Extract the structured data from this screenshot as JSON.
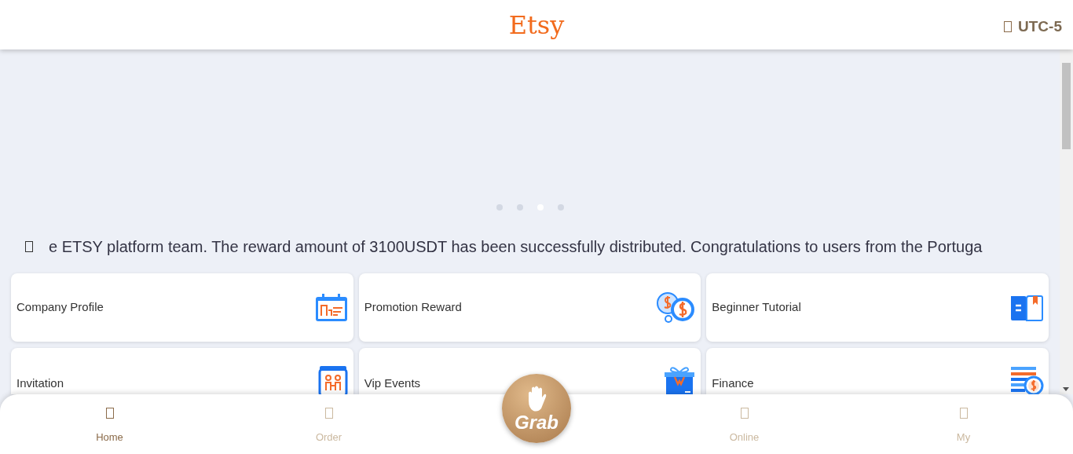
{
  "header": {
    "logo": "Etsy",
    "timezone": "UTC-5"
  },
  "carousel": {
    "dots": [
      {
        "selected": false
      },
      {
        "selected": false
      },
      {
        "selected": true
      },
      {
        "selected": false
      }
    ]
  },
  "notice": {
    "text": "e ETSY platform team. The reward amount of 3100USDT has been successfully distributed. Congratulations to users from the Portuga"
  },
  "menu": [
    {
      "label": "Company Profile",
      "kind": "profile"
    },
    {
      "label": "Promotion Reward",
      "kind": "coins"
    },
    {
      "label": "Beginner Tutorial",
      "kind": "book"
    },
    {
      "label": "Invitation",
      "kind": "invite"
    },
    {
      "label": "Vip Events",
      "kind": "gift"
    },
    {
      "label": "Finance",
      "kind": "finance"
    }
  ],
  "bottom_nav": {
    "items": [
      {
        "label": "Home",
        "selected": true
      },
      {
        "label": "Order",
        "selected": false
      },
      {
        "label": "Online",
        "selected": false
      },
      {
        "label": "My",
        "selected": false
      }
    ],
    "grab": "Grab"
  }
}
